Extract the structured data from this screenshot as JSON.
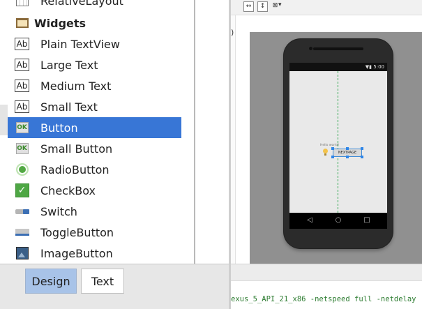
{
  "palette": {
    "items": [
      {
        "label": "RelativeLayout",
        "icon": "relative-layout-icon",
        "kind": "layout"
      },
      {
        "label": "Widgets",
        "icon": "folder-icon",
        "kind": "category"
      },
      {
        "label": "Plain TextView",
        "icon": "ab-text-icon",
        "kind": "item"
      },
      {
        "label": "Large Text",
        "icon": "ab-text-icon",
        "kind": "item"
      },
      {
        "label": "Medium Text",
        "icon": "ab-text-icon",
        "kind": "item"
      },
      {
        "label": "Small Text",
        "icon": "ab-text-icon",
        "kind": "item"
      },
      {
        "label": "Button",
        "icon": "ok-button-icon",
        "kind": "item",
        "selected": true
      },
      {
        "label": "Small Button",
        "icon": "ok-button-icon",
        "kind": "item"
      },
      {
        "label": "RadioButton",
        "icon": "radio-button-icon",
        "kind": "item"
      },
      {
        "label": "CheckBox",
        "icon": "checkbox-icon",
        "kind": "item"
      },
      {
        "label": "Switch",
        "icon": "switch-icon",
        "kind": "item"
      },
      {
        "label": "ToggleButton",
        "icon": "toggle-button-icon",
        "kind": "item"
      },
      {
        "label": "ImageButton",
        "icon": "image-button-icon",
        "kind": "item"
      }
    ],
    "icon_glyphs": {
      "ab": "Ab",
      "ok": "OK",
      "check": "✓"
    }
  },
  "tabs": {
    "design": "Design",
    "text": "Text",
    "active": "Design"
  },
  "toolbar": {
    "icons": [
      "fit-width-icon",
      "fit-height-icon",
      "zoom-options-icon"
    ],
    "glyphs": {
      "fit_width": "↔",
      "fit_height": "↕",
      "zoom": "⊠",
      "dropdown": "▾"
    }
  },
  "preview": {
    "status_time": "5:00",
    "status_icons": "▼▮",
    "hello_text": "Hello world!",
    "button_text": "NEXTPAGE",
    "nav_back": "◁",
    "nav_home": "○",
    "nav_recent": "□",
    "left_marker": ")"
  },
  "console": {
    "text": "exus_5_API_21_x86 -netspeed full -netdelay"
  },
  "colors": {
    "selection": "#3876d6",
    "design_tab": "#a8c3e8",
    "guide_line": "#34a853",
    "console_text": "#2e7d32",
    "selection_handles": "#2f86e8"
  }
}
